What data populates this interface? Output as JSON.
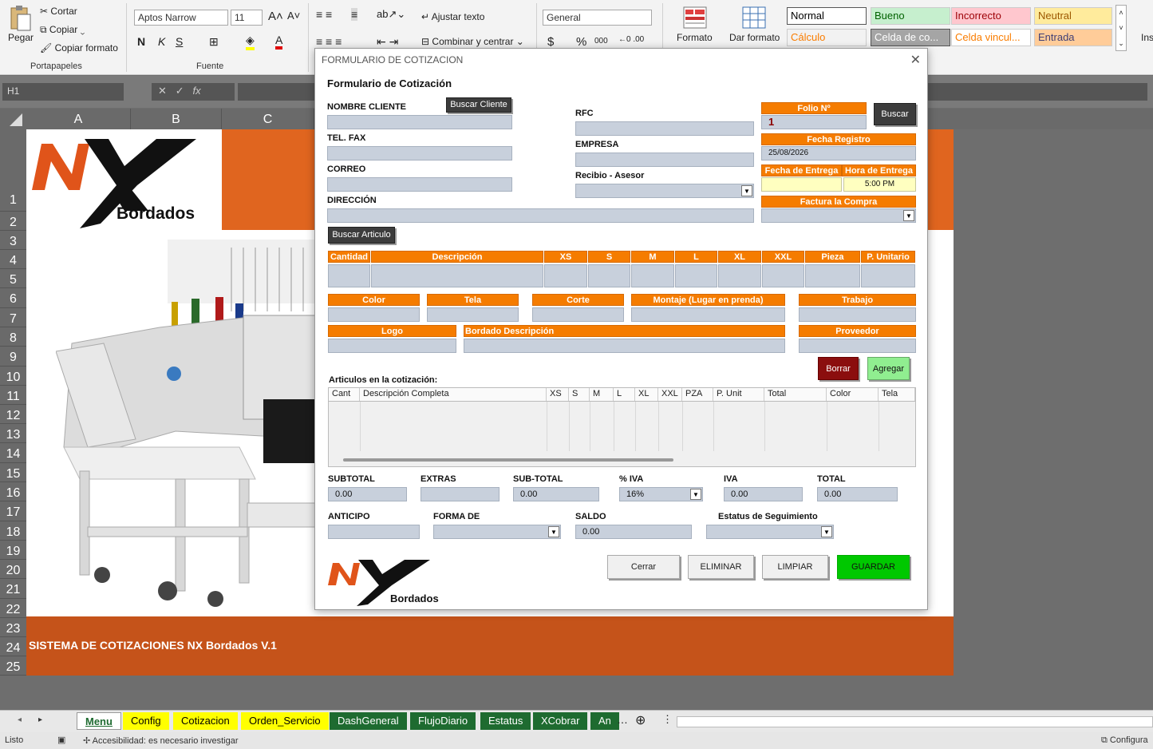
{
  "ribbon": {
    "clipboard": {
      "paste": "Pegar",
      "cut": "Cortar",
      "copy": "Copiar",
      "format_painter": "Copiar formato",
      "group": "Portapapeles"
    },
    "font": {
      "name": "Aptos Narrow",
      "size": "11",
      "bold": "N",
      "italic": "K",
      "underline": "S",
      "group": "Fuente"
    },
    "alignment": {
      "wrap": "Ajustar texto",
      "merge": "Combinar y centrar"
    },
    "number": {
      "format": "General",
      "currency": "$",
      "percent": "%",
      "thousands": "000"
    },
    "conditional": "Formato",
    "format_table": "Dar formato",
    "styles": [
      {
        "label": "Normal",
        "bg": "#ffffff",
        "fg": "#000000"
      },
      {
        "label": "Bueno",
        "bg": "#c6efce",
        "fg": "#006100"
      },
      {
        "label": "Incorrecto",
        "bg": "#ffc7ce",
        "fg": "#9c0006"
      },
      {
        "label": "Neutral",
        "bg": "#ffeb9c",
        "fg": "#9c5700"
      },
      {
        "label": "Cálculo",
        "bg": "#f2f2f2",
        "fg": "#fa7d00"
      },
      {
        "label": "Celda de co...",
        "bg": "#a5a5a5",
        "fg": "#ffffff"
      },
      {
        "label": "Celda vincul...",
        "bg": "#ffffff",
        "fg": "#fa7d00"
      },
      {
        "label": "Entrada",
        "bg": "#ffcc99",
        "fg": "#3f3f76"
      }
    ],
    "insert": "Ins"
  },
  "formula_bar": {
    "name_box": "H1",
    "fx": "fx",
    "content": ""
  },
  "columns": [
    "A",
    "B",
    "C"
  ],
  "rows": [
    "1",
    "2",
    "3",
    "4",
    "5",
    "6",
    "7",
    "8",
    "9",
    "10",
    "11",
    "12",
    "13",
    "14",
    "15",
    "16",
    "17",
    "18",
    "19",
    "20",
    "21",
    "22",
    "23",
    "24",
    "25"
  ],
  "sheet": {
    "logo_brand": "Bordados",
    "footer_title": "SISTEMA DE COTIZACIONES NX Bordados V.1"
  },
  "tabs": [
    {
      "label": "Menu",
      "bg": "#ffffff",
      "fg": "#1e6b30",
      "active": true
    },
    {
      "label": "Config",
      "bg": "#ffff00",
      "fg": "#000000"
    },
    {
      "label": "Cotizacion",
      "bg": "#ffff00",
      "fg": "#000000"
    },
    {
      "label": "Orden_Servicio",
      "bg": "#ffff00",
      "fg": "#000000"
    },
    {
      "label": "DashGeneral",
      "bg": "#1e6b30",
      "fg": "#ffffff"
    },
    {
      "label": "FlujoDiario",
      "bg": "#1e6b30",
      "fg": "#ffffff"
    },
    {
      "label": "Estatus",
      "bg": "#1e6b30",
      "fg": "#ffffff"
    },
    {
      "label": "XCobrar",
      "bg": "#1e6b30",
      "fg": "#ffffff"
    },
    {
      "label": "An",
      "bg": "#1e6b30",
      "fg": "#ffffff"
    }
  ],
  "status_bar": {
    "ready": "Listo",
    "accessibility": "Accesibilidad: es necesario investigar",
    "config": "Configura"
  },
  "dialog": {
    "window_title": "FORMULARIO DE COTIZACION",
    "heading": "Formulario de Cotización",
    "labels": {
      "nombre_cliente": "NOMBRE CLIENTE",
      "tel_fax": "TEL. FAX",
      "correo": "CORREO",
      "direccion": "DIRECCIÓN",
      "rfc": "RFC",
      "empresa": "EMPRESA",
      "recibio": "Recibio - Asesor",
      "folio": "Folio Nº",
      "fecha_registro": "Fecha Registro",
      "fecha_entrega": "Fecha de Entrega",
      "hora_entrega": "Hora de Entrega",
      "factura": "Factura la Compra",
      "articulos": "Articulos en la cotización:"
    },
    "values": {
      "folio": "1",
      "fecha_registro": "25/08/2026",
      "hora_entrega": "5:00 PM"
    },
    "buttons": {
      "buscar_cliente": "Buscar Cliente",
      "buscar": "Buscar",
      "buscar_articulo": "Buscar Articulo",
      "borrar": "Borrar",
      "agregar": "Agregar",
      "cerrar": "Cerrar",
      "eliminar": "ELIMINAR",
      "limpiar": "LIMPIAR",
      "guardar": "GUARDAR"
    },
    "item_headers": [
      "Cantidad",
      "Descripción",
      "XS",
      "S",
      "M",
      "L",
      "XL",
      "XXL",
      "Pieza",
      "P. Unitario"
    ],
    "attr_headers": [
      "Color",
      "Tela",
      "Corte",
      "Montaje (Lugar en prenda)",
      "Trabajo"
    ],
    "attr_headers2": [
      "Logo",
      "Bordado Descripción",
      "Proveedor"
    ],
    "grid_columns": [
      "Cant",
      "Descripción Completa",
      "XS",
      "S",
      "M",
      "L",
      "XL",
      "XXL",
      "PZA",
      "P. Unit",
      "Total",
      "Color",
      "Tela"
    ],
    "totals": {
      "subtotal_label": "SUBTOTAL",
      "subtotal": "0.00",
      "extras_label": "EXTRAS",
      "extras": "",
      "sub_total_label": "SUB-TOTAL",
      "sub_total": "0.00",
      "iva_pct_label": "% IVA",
      "iva_pct": "16%",
      "iva_label": "IVA",
      "iva": "0.00",
      "total_label": "TOTAL",
      "total": "0.00",
      "anticipo_label": "ANTICIPO",
      "anticipo": "",
      "forma_label": "FORMA DE",
      "forma": "",
      "saldo_label": "SALDO",
      "saldo": "0.00",
      "estatus_label": "Estatus de Seguimiento",
      "estatus": ""
    },
    "logo_brand": "Bordados"
  }
}
